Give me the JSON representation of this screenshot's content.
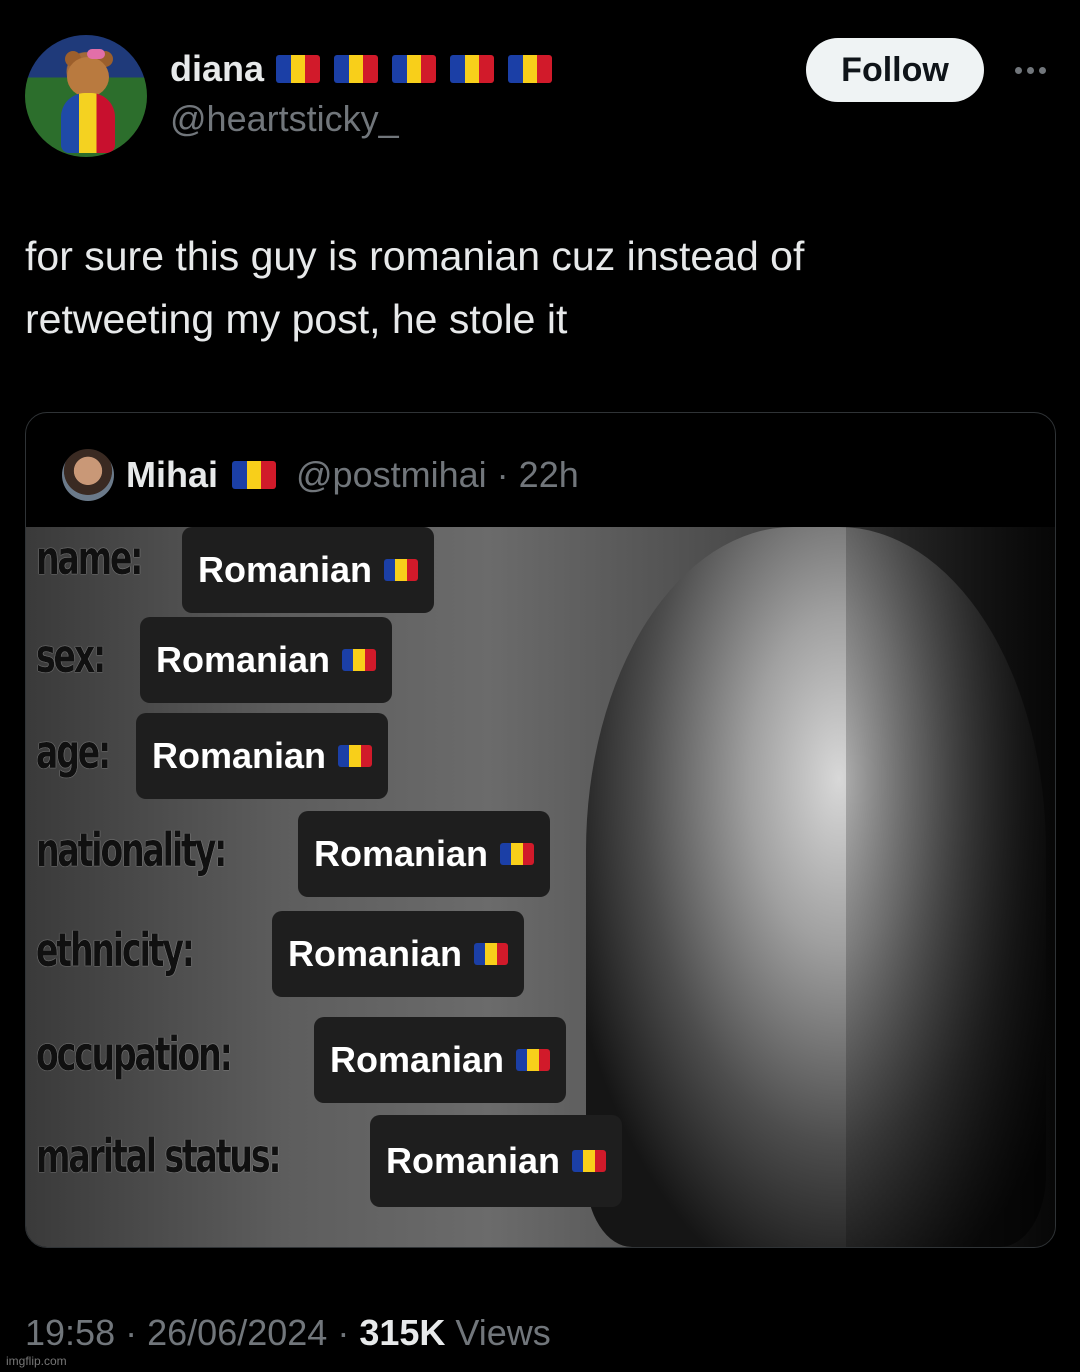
{
  "author": {
    "display_name": "diana",
    "flag_count_icon": "romania-flag-icon",
    "handle": "@heartsticky_"
  },
  "actions": {
    "follow_label": "Follow"
  },
  "tweet": {
    "text_line1": "for sure this guy is romanian cuz instead of",
    "text_line2": "retweeting my post, he stole it"
  },
  "quote": {
    "name": "Mihai",
    "handle": "@postmihai",
    "separator": "·",
    "age": "22h",
    "meme_fields": [
      {
        "label": "name:",
        "value": "Romanian"
      },
      {
        "label": "sex:",
        "value": "Romanian"
      },
      {
        "label": "age:",
        "value": "Romanian"
      },
      {
        "label": "nationality:",
        "value": "Romanian"
      },
      {
        "label": "ethnicity:",
        "value": "Romanian"
      },
      {
        "label": "occupation:",
        "value": "Romanian"
      },
      {
        "label": "marital status:",
        "value": "Romanian"
      }
    ]
  },
  "footer": {
    "time": "19:58",
    "sep": "·",
    "date": "26/06/2024",
    "views_count": "315K",
    "views_label": "Views"
  },
  "watermark": "imgflip.com",
  "colors": {
    "flag_blue": "#1b3fa6",
    "flag_yellow": "#f8cf1a",
    "flag_red": "#d11a2a",
    "muted": "#71767b",
    "text": "#e7e9ea"
  }
}
